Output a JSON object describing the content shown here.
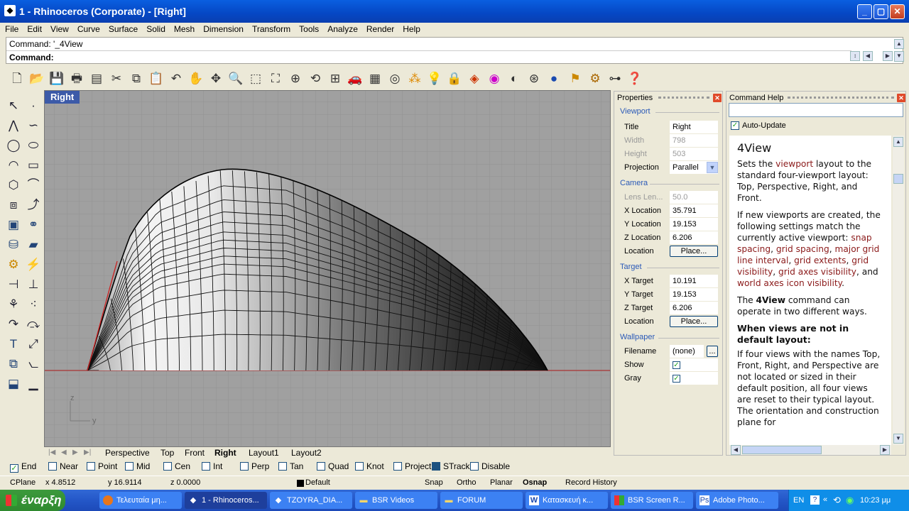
{
  "window": {
    "title": "1 - Rhinoceros (Corporate) - [Right]",
    "minimize_icon": "minimize-icon",
    "maximize_icon": "maximize-icon",
    "close_icon": "close-icon"
  },
  "menu": [
    "File",
    "Edit",
    "View",
    "Curve",
    "Surface",
    "Solid",
    "Mesh",
    "Dimension",
    "Transform",
    "Tools",
    "Analyze",
    "Render",
    "Help"
  ],
  "command": {
    "history": "Command: '_4View",
    "prompt_label": "Command:",
    "value": ""
  },
  "viewport": {
    "title": "Right",
    "axis_z": "z",
    "axis_y": "y"
  },
  "view_tabs": [
    "Perspective",
    "Top",
    "Front",
    "Right",
    "Layout1",
    "Layout2"
  ],
  "active_view_tab": "Right",
  "osnap": [
    {
      "label": "End",
      "checked": true
    },
    {
      "label": "Near",
      "checked": false
    },
    {
      "label": "Point",
      "checked": false
    },
    {
      "label": "Mid",
      "checked": false
    },
    {
      "label": "Cen",
      "checked": false
    },
    {
      "label": "Int",
      "checked": false
    },
    {
      "label": "Perp",
      "checked": false
    },
    {
      "label": "Tan",
      "checked": false
    },
    {
      "label": "Quad",
      "checked": false
    },
    {
      "label": "Knot",
      "checked": false
    },
    {
      "label": "Project",
      "checked": false
    },
    {
      "label": "STrack",
      "checked": true
    },
    {
      "label": "Disable",
      "checked": false
    }
  ],
  "status": {
    "cplane": "CPlane",
    "x": "x 4.8512",
    "y": "y 16.9114",
    "z": "z 0.0000",
    "layer": "Default",
    "snap": "Snap",
    "ortho": "Ortho",
    "planar": "Planar",
    "osnap": "Osnap",
    "record": "Record History"
  },
  "properties": {
    "header": "Properties",
    "viewport_section": "Viewport",
    "title_label": "Title",
    "title_value": "Right",
    "width_label": "Width",
    "width_value": "798",
    "height_label": "Height",
    "height_value": "503",
    "projection_label": "Projection",
    "projection_value": "Parallel",
    "camera_section": "Camera",
    "lens_label": "Lens Len...",
    "lens_value": "50.0",
    "xloc_label": "X Location",
    "xloc_value": "35.791",
    "yloc_label": "Y Location",
    "yloc_value": "19.153",
    "zloc_label": "Z Location",
    "zloc_value": "6.206",
    "location_label": "Location",
    "place_button": "Place...",
    "target_section": "Target",
    "xt_label": "X Target",
    "xt_value": "10.191",
    "yt_label": "Y Target",
    "yt_value": "19.153",
    "zt_label": "Z Target",
    "zt_value": "6.206",
    "tloc_label": "Location",
    "tplace_button": "Place...",
    "wallpaper_section": "Wallpaper",
    "filename_label": "Filename",
    "filename_value": "(none)",
    "browse_button": "...",
    "show_label": "Show",
    "gray_label": "Gray"
  },
  "help": {
    "header": "Command Help",
    "auto_update": "Auto-Update",
    "title": "4View",
    "p1_a": "Sets the ",
    "p1_link": "viewport",
    "p1_b": " layout to the standard four-viewport layout: Top, Perspective, Right, and Front.",
    "p2_a": "If new viewports are created, the following settings match the currently active viewport: ",
    "p2_l1": "snap spacing",
    "p2_s1": ", ",
    "p2_l2": "grid spacing",
    "p2_s2": ", ",
    "p2_l3": "major grid line interval",
    "p2_s3": ", ",
    "p2_l4": "grid extents",
    "p2_s4": ", ",
    "p2_l5": "grid visibility",
    "p2_s5": ", ",
    "p2_l6": "grid axes visibility",
    "p2_s6": ", and ",
    "p2_l7": "world axes icon visibility",
    "p2_s7": ".",
    "p3_a": "The ",
    "p3_b": "4View",
    "p3_c": " command can operate in two different ways.",
    "h2": "When views are not in default layout:",
    "p4": "If four views with the names Top, Front, Right, and Perspective are not located or sized in their default position, all four views are reset to their typical layout. The orientation and construction plane for"
  },
  "taskbar": {
    "start": "έναρξη",
    "items": [
      "Τελευταία μη...",
      "1 - Rhinoceros...",
      "TZOYRA_DIA...",
      "BSR Videos",
      "FORUM",
      "Κατασκευή κ...",
      "BSR Screen R...",
      "Adobe Photo..."
    ],
    "lang": "EN",
    "time": "10:23 μμ"
  }
}
